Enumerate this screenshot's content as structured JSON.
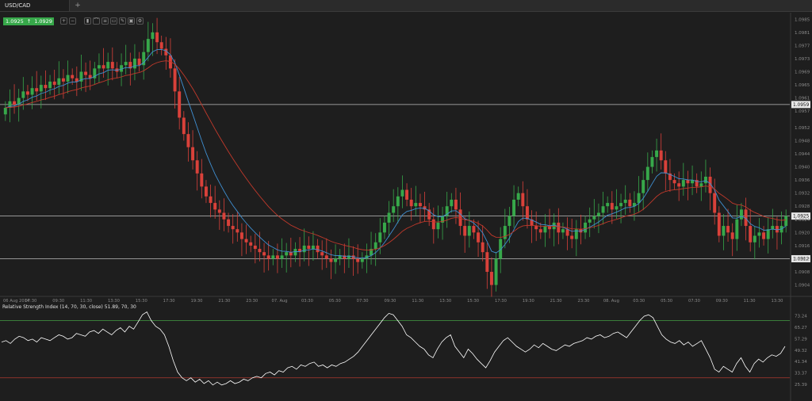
{
  "tab": {
    "label": "USD/CAD",
    "add": "+"
  },
  "toolbar": {
    "bid": "1.0925",
    "ask": "1.0929",
    "arrow": "↑",
    "tools": [
      "zoom-in-icon",
      "zoom-out-icon",
      "chart-type-icon",
      "draw-icon",
      "indicators-icon",
      "template-icon",
      "pen-icon",
      "screenshot-icon",
      "settings-icon"
    ]
  },
  "colors": {
    "bg": "#1e1e1e",
    "up": "#37a84a",
    "down": "#d9413a",
    "ema_fast": "#3f8fd1",
    "ema_slow": "#c0392b",
    "rsi_line": "#ffffff",
    "rsi_upper": "#3e8b3e",
    "rsi_lower": "#b03a2e",
    "hline": "#bdbdbd"
  },
  "chart_data": [
    {
      "type": "candlestick",
      "symbol": "USD/CAD",
      "ylim": [
        1.0901,
        1.0987
      ],
      "yticks": [
        "1.0985",
        "1.0981",
        "1.0977",
        "1.0973",
        "1.0969",
        "1.0965",
        "1.0961",
        "1.0957",
        "1.0952",
        "1.0948",
        "1.0944",
        "1.0940",
        "1.0936",
        "1.0932",
        "1.0928",
        "1.0924",
        "1.0920",
        "1.0916",
        "1.0912",
        "1.0908",
        "1.0904"
      ],
      "xticks": [
        "06 Aug 2014",
        "07:30",
        "09:30",
        "11:30",
        "13:30",
        "15:30",
        "17:30",
        "19:30",
        "21:30",
        "23:30",
        "07. Aug",
        "03:30",
        "05:30",
        "07:30",
        "09:30",
        "11:30",
        "13:30",
        "15:30",
        "17:30",
        "19:30",
        "21:30",
        "23:30",
        "08. Aug",
        "03:30",
        "05:30",
        "07:30",
        "09:30",
        "11:30",
        "13:30"
      ],
      "horizontal_lines": [
        "1.0959",
        "1.0925",
        "1.0912"
      ],
      "last_price": "1.0925",
      "close": [
        1.0958,
        1.096,
        1.0959,
        1.0961,
        1.0963,
        1.0962,
        1.0964,
        1.0963,
        1.0965,
        1.0964,
        1.0966,
        1.0965,
        1.0967,
        1.0966,
        1.0968,
        1.0967,
        1.0966,
        1.0969,
        1.0968,
        1.0967,
        1.097,
        1.0971,
        1.097,
        1.0972,
        1.097,
        1.0969,
        1.0971,
        1.0972,
        1.097,
        1.0973,
        1.0971,
        1.0975,
        1.0979,
        1.0981,
        1.0978,
        1.0976,
        1.0974,
        1.097,
        1.0963,
        1.0955,
        1.095,
        1.0946,
        1.0942,
        1.0938,
        1.0934,
        1.0931,
        1.0929,
        1.0927,
        1.0926,
        1.0924,
        1.0922,
        1.0921,
        1.092,
        1.0918,
        1.0917,
        1.0916,
        1.0915,
        1.0914,
        1.0913,
        1.0912,
        1.0913,
        1.0912,
        1.0913,
        1.0914,
        1.0913,
        1.0915,
        1.0914,
        1.0916,
        1.0915,
        1.0916,
        1.0914,
        1.0913,
        1.0912,
        1.0911,
        1.0912,
        1.0913,
        1.0912,
        1.0913,
        1.0912,
        1.0911,
        1.0912,
        1.0913,
        1.0915,
        1.0917,
        1.092,
        1.0923,
        1.0926,
        1.0928,
        1.0931,
        1.0933,
        1.093,
        1.0928,
        1.0929,
        1.0928,
        1.0927,
        1.0924,
        1.0921,
        1.0923,
        1.0925,
        1.0928,
        1.093,
        1.0927,
        1.0922,
        1.0919,
        1.0922,
        1.092,
        1.0917,
        1.0914,
        1.0908,
        1.0904,
        1.0912,
        1.0918,
        1.0922,
        1.0925,
        1.093,
        1.0932,
        1.0928,
        1.0924,
        1.0922,
        1.0921,
        1.092,
        1.0922,
        1.0921,
        1.0923,
        1.092,
        1.0921,
        1.0919,
        1.0918,
        1.0921,
        1.092,
        1.0923,
        1.0924,
        1.0925,
        1.0926,
        1.0928,
        1.0929,
        1.0927,
        1.0928,
        1.0929,
        1.093,
        1.0928,
        1.0929,
        1.0932,
        1.0936,
        1.094,
        1.0943,
        1.0945,
        1.0942,
        1.0938,
        1.0936,
        1.0935,
        1.0934,
        1.0936,
        1.0935,
        1.0936,
        1.0934,
        1.0935,
        1.0937,
        1.0932,
        1.0926,
        1.0919,
        1.0922,
        1.092,
        1.0918,
        1.0924,
        1.0927,
        1.0922,
        1.0917,
        1.0919,
        1.092,
        1.0918,
        1.0921,
        1.0922,
        1.092,
        1.0922,
        1.0925
      ]
    },
    {
      "type": "line",
      "title": "Relative Strength Index (14, 70, 30, close) 51.89, 70, 30",
      "ylim": [
        21,
        78
      ],
      "yticks": [
        "73.24",
        "65.27",
        "57.29",
        "49.32",
        "41.34",
        "33.37",
        "25.39"
      ],
      "levels": [
        70,
        30
      ],
      "values": [
        55,
        56,
        54,
        57,
        59,
        58,
        56,
        57,
        55,
        58,
        57,
        56,
        58,
        60,
        59,
        57,
        58,
        61,
        60,
        59,
        62,
        63,
        61,
        64,
        62,
        60,
        63,
        65,
        62,
        66,
        64,
        69,
        74,
        76,
        70,
        66,
        64,
        60,
        52,
        42,
        34,
        30,
        28,
        30,
        27,
        29,
        26,
        28,
        25,
        27,
        25,
        26,
        28,
        26,
        27,
        29,
        28,
        30,
        31,
        30,
        33,
        34,
        32,
        35,
        34,
        37,
        38,
        36,
        39,
        38,
        40,
        41,
        38,
        39,
        37,
        39,
        38,
        40,
        41,
        43,
        45,
        48,
        52,
        56,
        60,
        64,
        68,
        72,
        75,
        74,
        70,
        66,
        60,
        58,
        55,
        52,
        50,
        46,
        44,
        50,
        55,
        58,
        60,
        52,
        48,
        44,
        50,
        47,
        43,
        40,
        37,
        42,
        48,
        52,
        56,
        58,
        55,
        52,
        50,
        48,
        50,
        53,
        51,
        54,
        52,
        50,
        49,
        51,
        53,
        52,
        54,
        55,
        56,
        58,
        57,
        59,
        60,
        58,
        59,
        61,
        62,
        60,
        58,
        62,
        66,
        70,
        73,
        74,
        72,
        66,
        60,
        57,
        55,
        54,
        56,
        53,
        55,
        52,
        54,
        56,
        50,
        44,
        36,
        34,
        38,
        36,
        34,
        40,
        44,
        38,
        34,
        40,
        43,
        41,
        44,
        46,
        45,
        47,
        52
      ]
    }
  ]
}
